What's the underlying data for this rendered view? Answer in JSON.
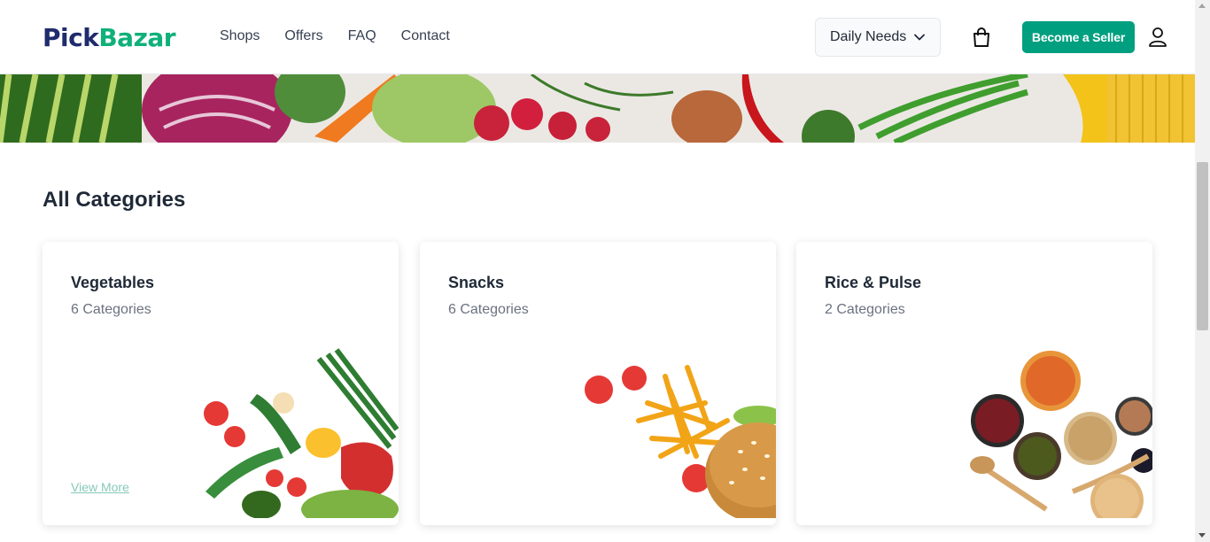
{
  "header": {
    "logo_part1": "Pick",
    "logo_part2": "Bazar",
    "nav": [
      "Shops",
      "Offers",
      "FAQ",
      "Contact"
    ],
    "shop_selector": "Daily Needs",
    "seller_button": "Become a Seller"
  },
  "section": {
    "title": "All Categories"
  },
  "categories": [
    {
      "name": "Vegetables",
      "count": "6 Categories",
      "link": "View More"
    },
    {
      "name": "Snacks",
      "count": "6 Categories"
    },
    {
      "name": "Rice & Pulse",
      "count": "2 Categories"
    }
  ],
  "colors": {
    "brand_dark": "#1f2b6c",
    "brand_green": "#0fb07a",
    "accent": "#009f7f"
  }
}
